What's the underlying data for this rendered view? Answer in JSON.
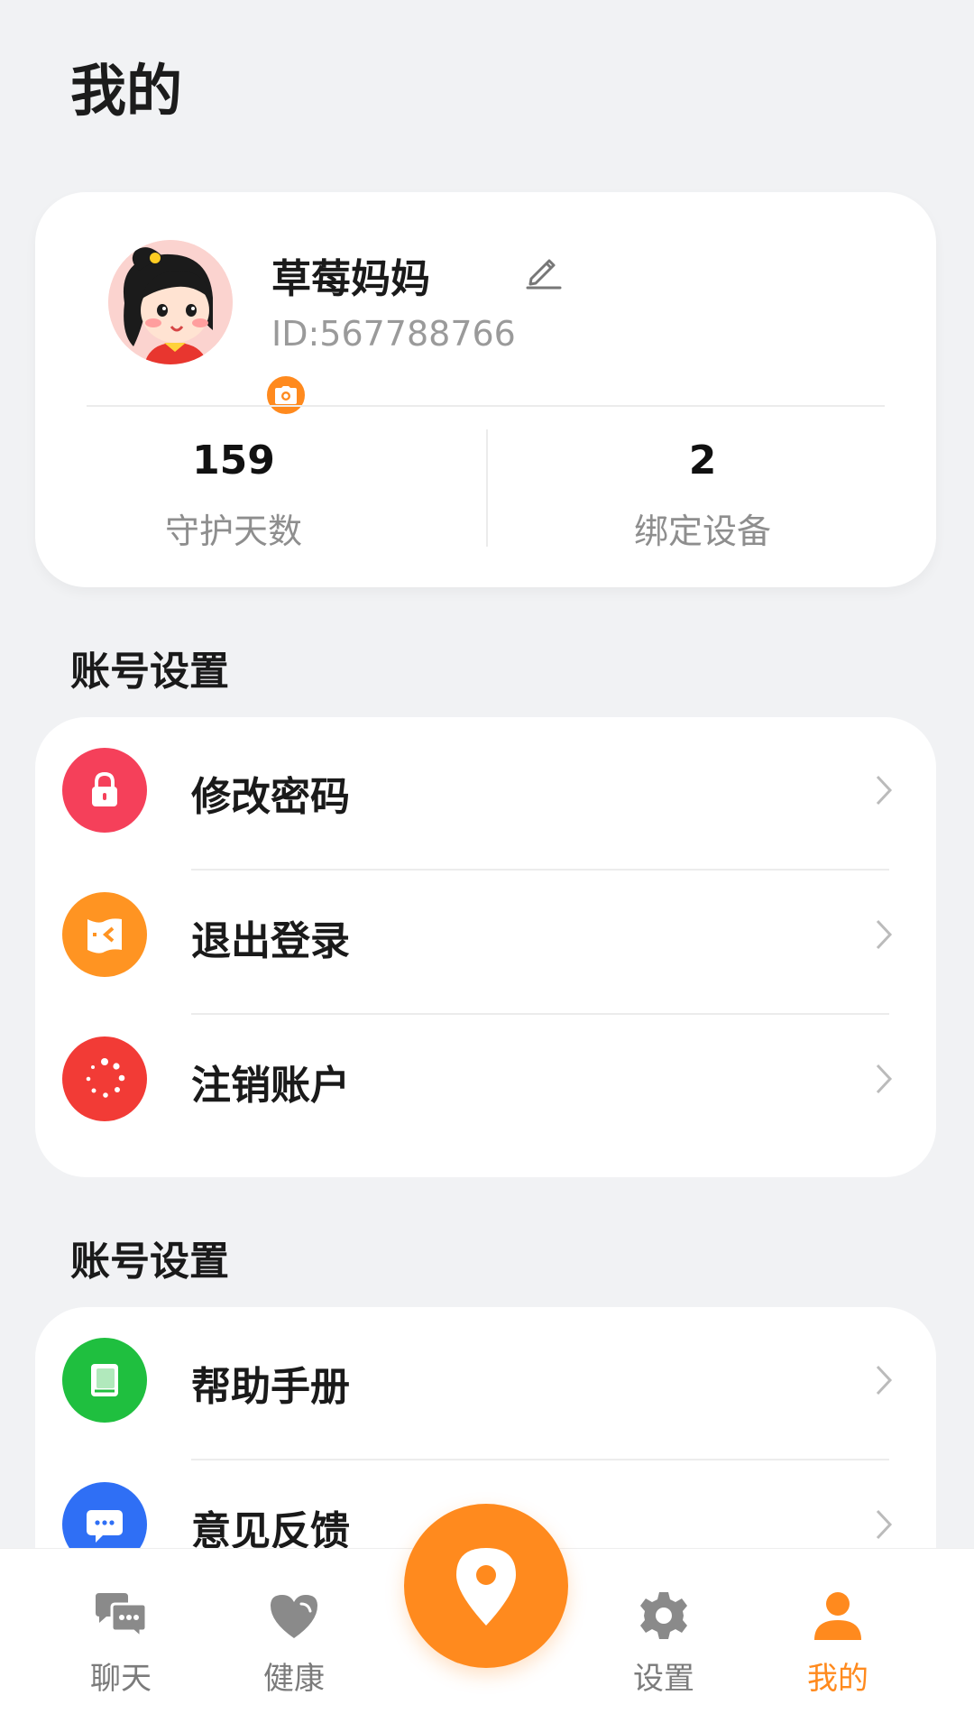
{
  "page_title": "我的",
  "profile": {
    "name": "草莓妈妈",
    "id_text": "ID:567788766",
    "stats": [
      {
        "value": "159",
        "label": "守护天数"
      },
      {
        "value": "2",
        "label": "绑定设备"
      }
    ]
  },
  "sections": [
    {
      "title": "账号设置",
      "items": [
        {
          "label": "修改密码",
          "icon": "lock-icon",
          "color": "#f5405a"
        },
        {
          "label": "退出登录",
          "icon": "logout-icon",
          "color": "#ff9422"
        },
        {
          "label": "注销账户",
          "icon": "spinner-icon",
          "color": "#f23b36"
        }
      ]
    },
    {
      "title": "账号设置",
      "items": [
        {
          "label": "帮助手册",
          "icon": "book-icon",
          "color": "#1fbf3f"
        },
        {
          "label": "意见反馈",
          "icon": "message-icon",
          "color": "#2f6ff5"
        }
      ]
    }
  ],
  "bottom_nav": {
    "items": [
      {
        "label": "聊天",
        "icon": "chat-icon",
        "active": false
      },
      {
        "label": "健康",
        "icon": "heart-icon",
        "active": false
      },
      {
        "label": "设置",
        "icon": "gear-icon",
        "active": false
      },
      {
        "label": "我的",
        "icon": "user-icon",
        "active": true
      }
    ],
    "center_button": {
      "icon": "location-pin-icon"
    }
  },
  "colors": {
    "accent": "#ff8a1e",
    "background": "#f1f2f4",
    "inactive_nav": "#7b7b7b"
  }
}
